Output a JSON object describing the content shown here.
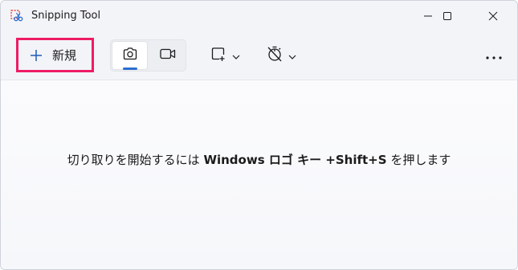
{
  "window": {
    "title": "Snipping Tool",
    "icon": "snipping-tool-icon"
  },
  "title_controls": {
    "minimize_icon": "minimize-icon",
    "maximize_icon": "maximize-icon",
    "close_icon": "close-icon"
  },
  "toolbar": {
    "new_label": "新規",
    "new_icon": "plus-icon",
    "mode_photo_icon": "camera-icon",
    "mode_video_icon": "video-camera-icon",
    "shape_icon": "rectangle-snip-icon",
    "delay_icon": "timer-off-icon",
    "more_icon": "more-horizontal-icon"
  },
  "content": {
    "hint_prefix": "切り取りを開始するには ",
    "hint_key": "Windows ロゴ キー +Shift+S",
    "hint_suffix": " を押します"
  },
  "colors": {
    "highlight_border": "#ee1c64",
    "accent": "#2a6ed1"
  }
}
